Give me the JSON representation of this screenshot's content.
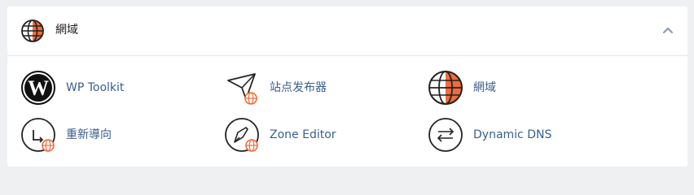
{
  "section": {
    "title": "網域",
    "icon": "globe-icon",
    "collapse_icon": "chevron-up-icon"
  },
  "items": [
    {
      "label": "WP Toolkit",
      "icon": "wordpress-icon"
    },
    {
      "label": "站点发布器",
      "icon": "site-publisher-icon"
    },
    {
      "label": "網域",
      "icon": "globe-icon"
    },
    {
      "label": "重新導向",
      "icon": "redirect-icon"
    },
    {
      "label": "Zone Editor",
      "icon": "zone-editor-icon"
    },
    {
      "label": "Dynamic DNS",
      "icon": "dynamic-dns-icon"
    }
  ],
  "colors": {
    "accent": "#ef6c3c",
    "link": "#3a5e8c",
    "border": "#e3e5e8",
    "background": "#eff0f2"
  }
}
